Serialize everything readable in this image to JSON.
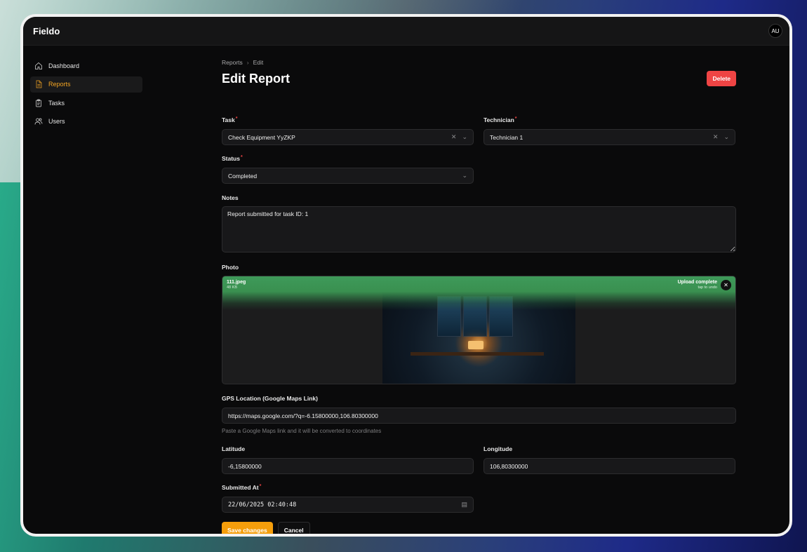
{
  "app": {
    "brand": "Fieldo",
    "avatar_initials": "AU"
  },
  "sidebar": {
    "items": [
      {
        "label": "Dashboard",
        "icon": "home-icon",
        "active": false
      },
      {
        "label": "Reports",
        "icon": "document-icon",
        "active": true
      },
      {
        "label": "Tasks",
        "icon": "clipboard-icon",
        "active": false
      },
      {
        "label": "Users",
        "icon": "users-icon",
        "active": false
      }
    ]
  },
  "breadcrumb": {
    "parent": "Reports",
    "current": "Edit"
  },
  "page": {
    "title": "Edit Report",
    "delete_label": "Delete"
  },
  "form": {
    "task": {
      "label": "Task",
      "required_mark": "*",
      "value": "Check Equipment YyZKP"
    },
    "technician": {
      "label": "Technician",
      "required_mark": "*",
      "value": "Technician 1"
    },
    "status": {
      "label": "Status",
      "required_mark": "*",
      "value": "Completed"
    },
    "notes": {
      "label": "Notes",
      "value": "Report submitted for task ID: 1"
    },
    "photo": {
      "label": "Photo",
      "file_name": "111.jpeg",
      "file_size": "48 KB",
      "upload_status": "Upload complete",
      "upload_hint": "tap to undo"
    },
    "gps": {
      "label": "GPS Location (Google Maps Link)",
      "value": "https://maps.google.com/?q=-6.15800000,106.80300000",
      "hint": "Paste a Google Maps link and it will be converted to coordinates"
    },
    "latitude": {
      "label": "Latitude",
      "value": "-6,15800000"
    },
    "longitude": {
      "label": "Longitude",
      "value": "106,80300000"
    },
    "submitted_at": {
      "label": "Submitted At",
      "required_mark": "*",
      "value": "22/06/2025 02:40:48"
    }
  },
  "actions": {
    "save_label": "Save changes",
    "cancel_label": "Cancel"
  },
  "colors": {
    "accent": "#f59e0b",
    "danger": "#ef4444",
    "active_nav": "#f5a623",
    "upload_success": "#3e9a5a"
  }
}
